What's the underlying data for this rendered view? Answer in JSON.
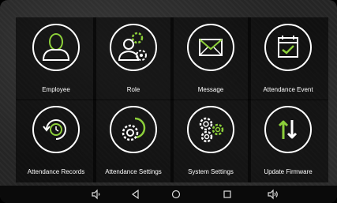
{
  "tiles": [
    {
      "label": "Employee",
      "icon": "employee-icon"
    },
    {
      "label": "Role",
      "icon": "role-icon"
    },
    {
      "label": "Message",
      "icon": "message-icon"
    },
    {
      "label": "Attendance Event",
      "icon": "attendance-event-icon"
    },
    {
      "label": "Attendance Records",
      "icon": "attendance-records-icon"
    },
    {
      "label": "Attendance Settings",
      "icon": "attendance-settings-icon"
    },
    {
      "label": "System Settings",
      "icon": "system-settings-icon"
    },
    {
      "label": "Update Firmware",
      "icon": "update-firmware-icon"
    }
  ],
  "navbar": {
    "icons": [
      "volume-down-icon",
      "back-icon",
      "home-icon",
      "recents-icon",
      "volume-up-icon"
    ]
  },
  "colors": {
    "accent": "#8ccf3a",
    "icon_stroke": "#ffffff",
    "background": "#262626"
  }
}
